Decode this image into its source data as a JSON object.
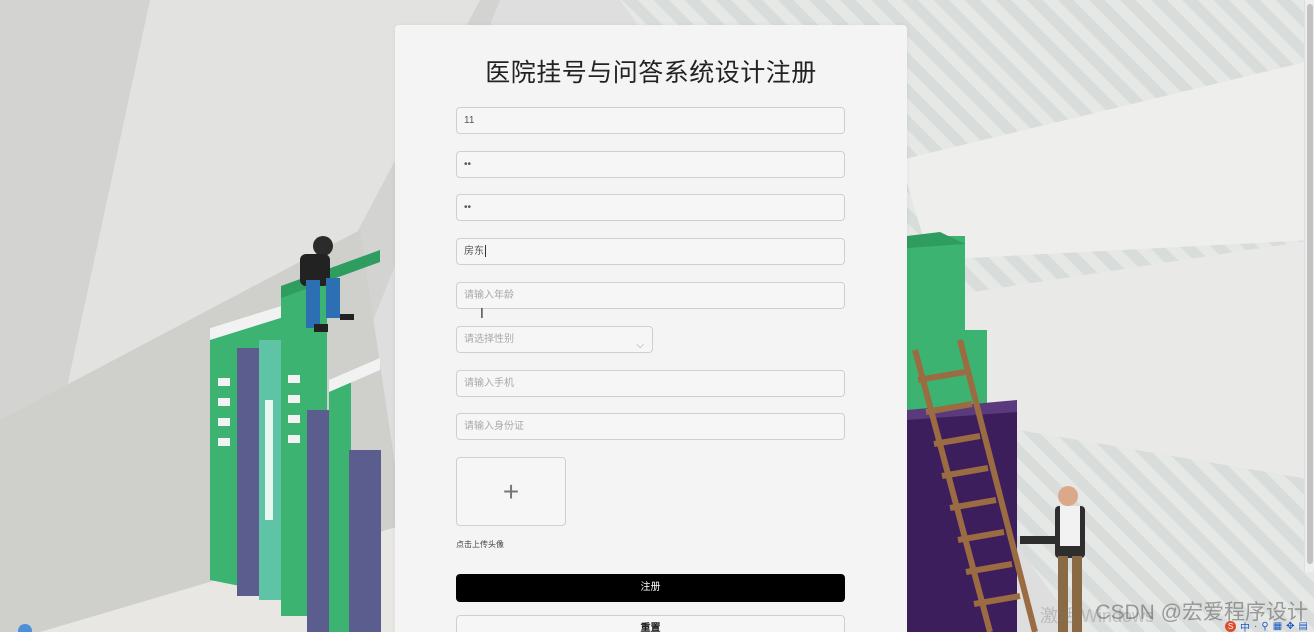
{
  "form": {
    "title": "医院挂号与问答系统设计注册",
    "fields": [
      {
        "value": "11",
        "placeholder": ""
      },
      {
        "value": "••",
        "placeholder": ""
      },
      {
        "value": "••",
        "placeholder": ""
      },
      {
        "value": "房东",
        "placeholder": ""
      },
      {
        "value": "",
        "placeholder": "请输入年龄"
      },
      {
        "value": "",
        "placeholder": "请选择性别"
      },
      {
        "value": "",
        "placeholder": "请输入手机"
      },
      {
        "value": "",
        "placeholder": "请输入身份证"
      }
    ],
    "upload_hint": "点击上传头像",
    "register_label": "注册",
    "reset_label": "重置"
  },
  "overlay": {
    "watermark": "CSDN @宏爱程序设计",
    "activate_text": "激活 Windows",
    "tray": [
      "S",
      "中",
      "·",
      "⚲",
      "▦",
      "✥",
      "▤"
    ]
  },
  "colors": {
    "primary_button": "#000000",
    "card": "#f4f4f4",
    "book_green": "#3cb371",
    "book_purple": "#3d1e5c",
    "background": "#d9d9d6"
  },
  "icons": {
    "upload": "plus-icon",
    "select": "chevron-down-icon"
  }
}
